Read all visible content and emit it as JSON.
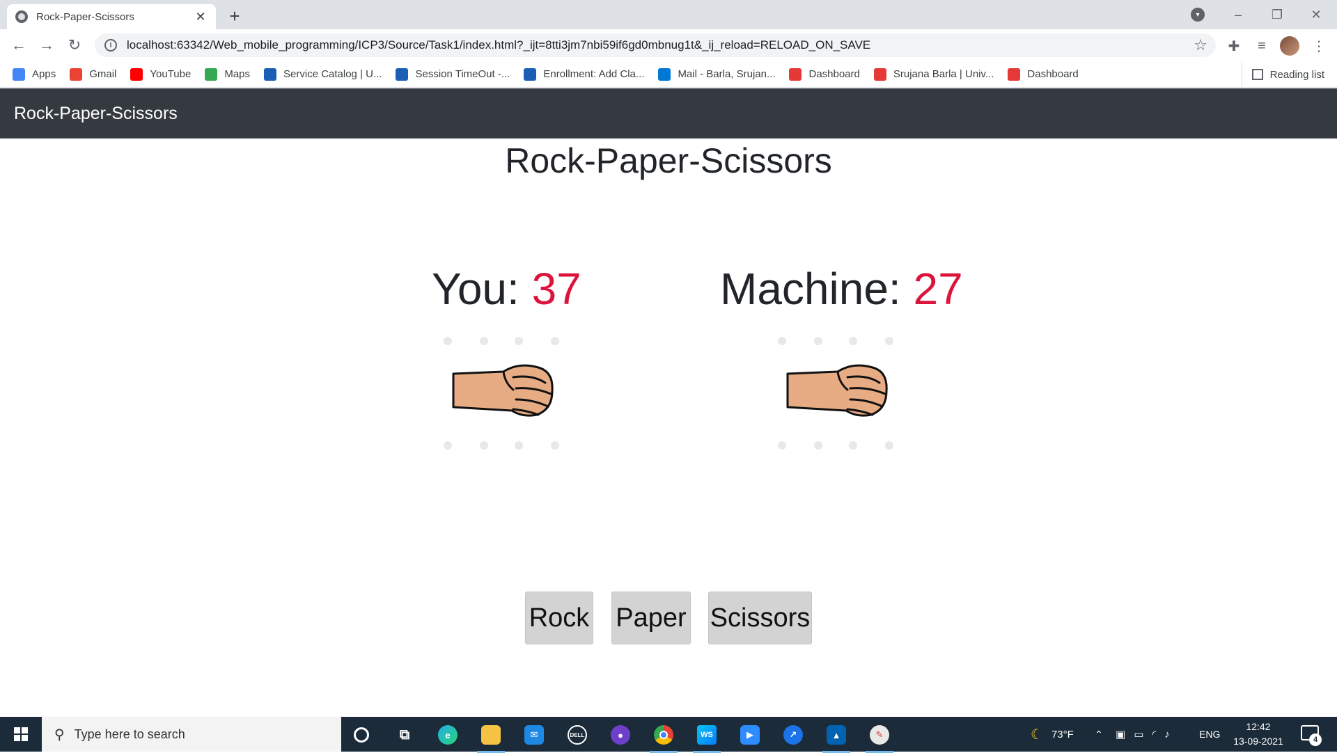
{
  "browser": {
    "tab_title": "Rock-Paper-Scissors",
    "tab_close": "✕",
    "new_tab": "+",
    "url": "localhost:63342/Web_mobile_programming/ICP3/Source/Task1/index.html?_ijt=8tti3jm7nbi59if6gd0mbnug1t&_ij_reload=RELOAD_ON_SAVE",
    "bookmarks": [
      {
        "label": "Apps",
        "icon": "apps-grid-icon",
        "color": "#4285f4"
      },
      {
        "label": "Gmail",
        "icon": "gmail-icon",
        "color": "#ea4335"
      },
      {
        "label": "YouTube",
        "icon": "youtube-icon",
        "color": "#ff0000"
      },
      {
        "label": "Maps",
        "icon": "maps-pin-icon",
        "color": "#34a853"
      },
      {
        "label": "Service Catalog | U...",
        "icon": "service-catalog-icon",
        "color": "#1a5fb4"
      },
      {
        "label": "Session TimeOut -...",
        "icon": "session-icon",
        "color": "#1a5fb4"
      },
      {
        "label": "Enrollment: Add Cla...",
        "icon": "enrollment-icon",
        "color": "#1a5fb4"
      },
      {
        "label": "Mail - Barla, Srujan...",
        "icon": "outlook-icon",
        "color": "#0078d4"
      },
      {
        "label": "Dashboard",
        "icon": "dashboard-icon",
        "color": "#e53935"
      },
      {
        "label": "Srujana Barla | Univ...",
        "icon": "university-icon",
        "color": "#e53935"
      },
      {
        "label": "Dashboard",
        "icon": "dashboard-icon",
        "color": "#e53935"
      }
    ],
    "reading_list": "Reading list"
  },
  "app": {
    "brand": "Rock-Paper-Scissors",
    "heading": "Rock-Paper-Scissors",
    "you_label": "You:",
    "you_score": "37",
    "machine_label": "Machine:",
    "machine_score": "27",
    "you_choice": "rock",
    "machine_choice": "rock",
    "buttons": {
      "rock": "Rock",
      "paper": "Paper",
      "scissors": "Scissors"
    },
    "colors": {
      "navbar": "#343a40",
      "score": "#dc143c",
      "button": "#d3d3d3"
    }
  },
  "taskbar": {
    "search_placeholder": "Type here to search",
    "weather": "73°F",
    "language": "ENG",
    "time": "12:42",
    "date": "13-09-2021",
    "notifications": "4"
  }
}
